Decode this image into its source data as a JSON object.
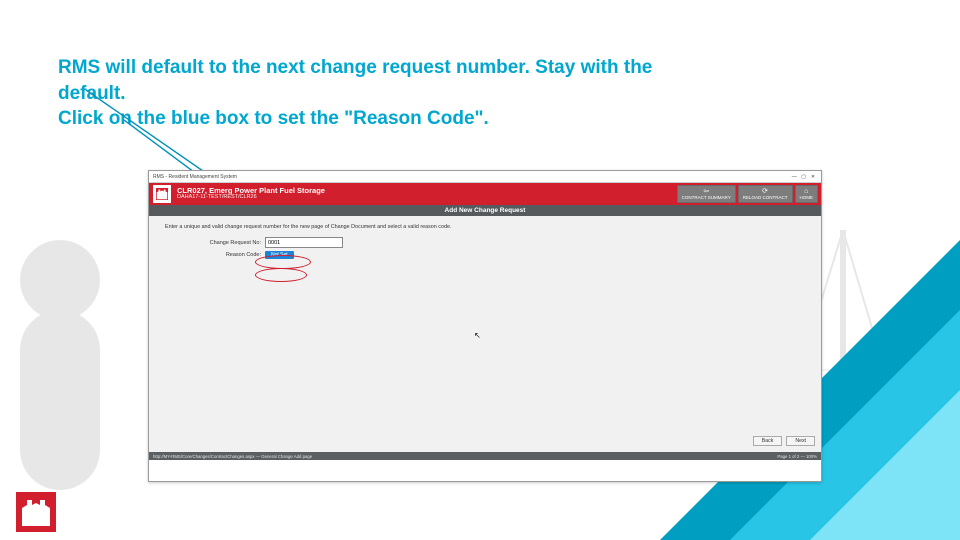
{
  "heading": {
    "line1": "RMS will default to the next change request number. Stay with the default.",
    "line2": "Click on the blue box to set the \"Reason Code\"."
  },
  "window": {
    "app_title": "RMS - Resident Management System",
    "ctrl_min": "—",
    "ctrl_max": "▢",
    "ctrl_close": "✕",
    "project_code": "CLR027, Emerg Power Plant Fuel Storage",
    "project_sub": "DAHA17-11-TEST/REST/CLR26",
    "btn_back": "CONTRACT SUMMARY",
    "btn_reload": "RELOAD CONTRACT",
    "btn_home": "HOME",
    "section_title": "Add New Change Request",
    "instruction": "Enter a unique and valid change request number for the new page of Change Document and select a valid reason code.",
    "label_change_no": "Change Request No:",
    "value_change_no": "0001",
    "label_reason": "Reason Code:",
    "reason_btn": "Not Set",
    "btn_back2": "Back",
    "btn_next": "Next",
    "status_left": "http://MY-RMS/Core/Changes/ContractChanges.aspx — General Change Add page",
    "status_right": "Page 1 of 2 — 100%"
  }
}
